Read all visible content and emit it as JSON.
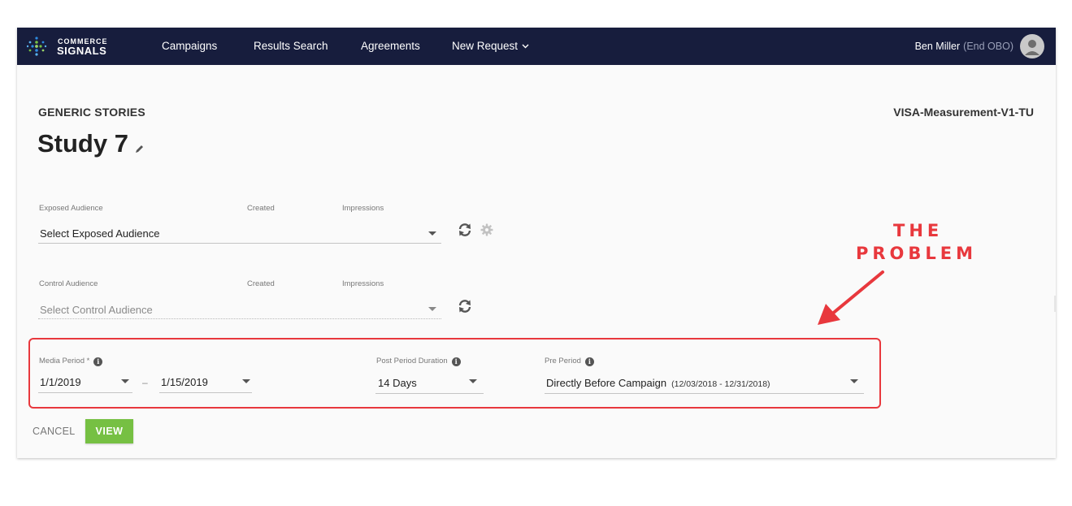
{
  "brand": {
    "line1": "COMMERCE",
    "line2": "SIGNALS",
    "dot_colors": [
      "#2e8be0",
      "#5ab2f0",
      "#76c043",
      "#9bd46a"
    ]
  },
  "nav": {
    "campaigns": "Campaigns",
    "results_search": "Results Search",
    "agreements": "Agreements",
    "new_request": "New Request",
    "bg_color": "#171d3d"
  },
  "user": {
    "name": "Ben Miller",
    "obo": "(End OBO)"
  },
  "header": {
    "category": "GENERIC STORIES",
    "title": "Study 7",
    "model": "VISA-Measurement-V1-TU"
  },
  "exposed": {
    "label": "Exposed Audience",
    "created_label": "Created",
    "impressions_label": "Impressions",
    "value": "Select Exposed Audience"
  },
  "control": {
    "label": "Control Audience",
    "created_label": "Created",
    "impressions_label": "Impressions",
    "placeholder": "Select Control Audience"
  },
  "media_period": {
    "label": "Media Period *",
    "start": "1/1/2019",
    "separator": "–",
    "end": "1/15/2019"
  },
  "post_period": {
    "label": "Post Period Duration",
    "value": "14 Days"
  },
  "pre_period": {
    "label": "Pre Period",
    "value": "Directly Before Campaign",
    "range": "(12/03/2018 - 12/31/2018)"
  },
  "actions": {
    "cancel": "CANCEL",
    "view": "VIEW",
    "view_color": "#76c043"
  },
  "annotation": {
    "line1": "THE",
    "line2": "PROBLEM",
    "color": "#e8383d"
  }
}
